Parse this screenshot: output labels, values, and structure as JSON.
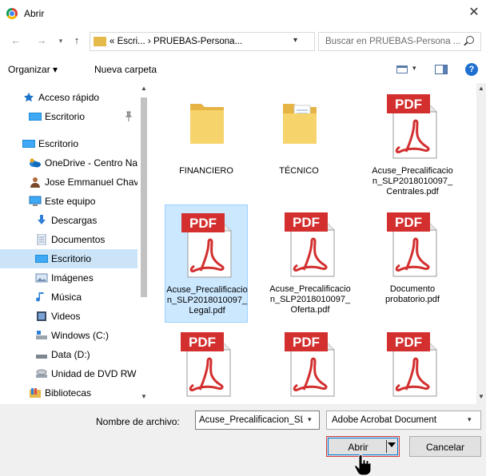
{
  "window": {
    "title": "Abrir",
    "close_glyph": "✕"
  },
  "nav": {
    "back": "←",
    "forward": "→",
    "up": "↑",
    "address": "« Escri... › PRUEBAS-Persona...",
    "refresh": "↻"
  },
  "search": {
    "placeholder": "Buscar en PRUEBAS-Persona ..."
  },
  "toolbar": {
    "organize_label": "Organizar ▾",
    "new_folder_label": "Nueva carpeta",
    "help": "?"
  },
  "sidebar": {
    "items": [
      {
        "label": "Acceso rápido",
        "icon": "star-icon"
      },
      {
        "label": "Escritorio",
        "icon": "desktop-icon",
        "pin": "pin-icon"
      },
      {
        "label": "Escritorio",
        "icon": "desktop-icon"
      },
      {
        "label": "OneDrive - Centro Na",
        "icon": "onedrive-icon"
      },
      {
        "label": "Jose Emmanuel Chave",
        "icon": "user-icon"
      },
      {
        "label": "Este equipo",
        "icon": "computer-icon"
      },
      {
        "label": "Descargas",
        "icon": "download-icon"
      },
      {
        "label": "Documentos",
        "icon": "documents-icon"
      },
      {
        "label": "Escritorio",
        "icon": "desktop-icon",
        "selected": true
      },
      {
        "label": "Imágenes",
        "icon": "pictures-icon"
      },
      {
        "label": "Música",
        "icon": "music-icon"
      },
      {
        "label": "Videos",
        "icon": "videos-icon"
      },
      {
        "label": "Windows (C:)",
        "icon": "drive-c-icon"
      },
      {
        "label": "Data (D:)",
        "icon": "drive-d-icon"
      },
      {
        "label": "Unidad de DVD RW (",
        "icon": "dvd-icon"
      },
      {
        "label": "Bibliotecas",
        "icon": "libraries-icon"
      }
    ]
  },
  "files": [
    {
      "name": "FINANCIERO",
      "type": "folder"
    },
    {
      "name": "TÉCNICO",
      "type": "folder"
    },
    {
      "name": "Acuse_Precalificacion_SLP2018010097_Centrales.pdf",
      "type": "pdf"
    },
    {
      "name": "Acuse_Precalificacion_SLP2018010097_Legal.pdf",
      "type": "pdf",
      "selected": true
    },
    {
      "name": "Acuse_Precalificacion_SLP2018010097_Oferta.pdf",
      "type": "pdf"
    },
    {
      "name": "Documento probatorio.pdf",
      "type": "pdf"
    },
    {
      "name": "",
      "type": "pdf"
    },
    {
      "name": "",
      "type": "pdf"
    },
    {
      "name": "",
      "type": "pdf"
    }
  ],
  "pdf_label": "PDF",
  "footer": {
    "filename_label": "Nombre de archivo:",
    "filename_value": "Acuse_Precalificacion_SL",
    "filter_value": "Adobe Acrobat Document",
    "open_label": "Abrir",
    "cancel_label": "Cancelar"
  },
  "colors": {
    "selection": "#cce8ff",
    "pdf_red": "#d32f2f",
    "folder": "#f2c94c",
    "accent": "#0078d7"
  }
}
